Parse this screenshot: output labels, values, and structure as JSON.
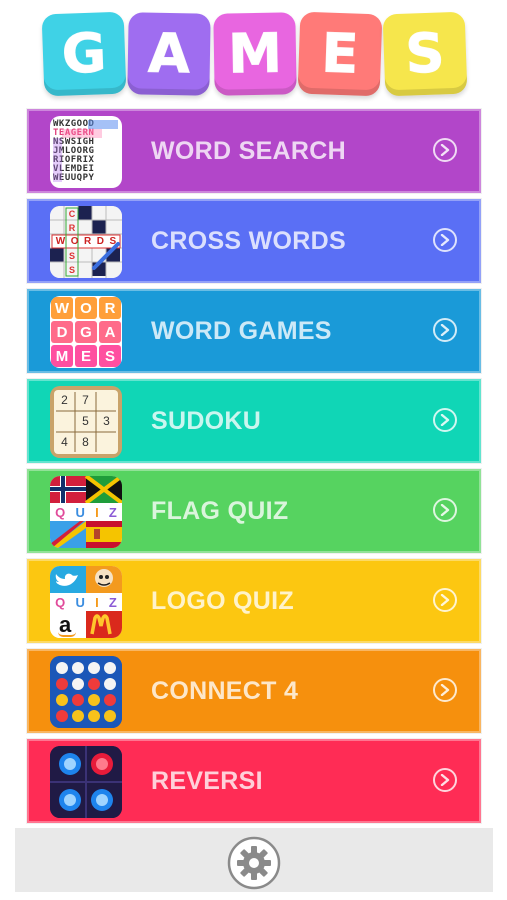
{
  "title": {
    "letters": [
      "G",
      "A",
      "M",
      "E",
      "S"
    ],
    "colors": [
      "#3fd2e6",
      "#9f6df0",
      "#e866e0",
      "#ff7a78",
      "#f6e64c"
    ]
  },
  "menu": {
    "items": [
      {
        "label": "WORD SEARCH",
        "color": "#b246c9",
        "icon": "word-search-icon"
      },
      {
        "label": "CROSS WORDS",
        "color": "#5a6ff5",
        "icon": "crossword-icon"
      },
      {
        "label": "WORD GAMES",
        "color": "#1a9ad8",
        "icon": "word-games-icon"
      },
      {
        "label": "SUDOKU",
        "color": "#10d6b6",
        "icon": "sudoku-icon"
      },
      {
        "label": "FLAG QUIZ",
        "color": "#56d360",
        "icon": "flag-quiz-icon"
      },
      {
        "label": "LOGO QUIZ",
        "color": "#fcc711",
        "icon": "logo-quiz-icon"
      },
      {
        "label": "CONNECT 4",
        "color": "#f6900d",
        "icon": "connect-4-icon"
      },
      {
        "label": "REVERSI",
        "color": "#ff2c55",
        "icon": "reversi-icon"
      }
    ]
  },
  "thumbs": {
    "word_search_rows": [
      "WKZGOOD",
      "TEAGERN",
      "NSWSIGH",
      "JMLOORG",
      "RIOFRIX",
      "VLEMDEI",
      "WEUUQPY"
    ],
    "crossword_letters": {
      "down": [
        "C",
        "R",
        "O",
        "S",
        "S"
      ],
      "across": [
        "W",
        "O",
        "R",
        "D",
        "S"
      ]
    },
    "word_games_tiles": [
      "W",
      "O",
      "R",
      "D",
      "G",
      "A",
      "M",
      "E",
      "S"
    ],
    "sudoku_digits": [
      "2",
      "7",
      "5",
      "3",
      "4",
      "8"
    ],
    "quiz_letters": [
      "Q",
      "U",
      "I",
      "Z"
    ],
    "logo_quiz_bottom": "a"
  },
  "bottom": {
    "settings_icon": "gear-icon"
  }
}
